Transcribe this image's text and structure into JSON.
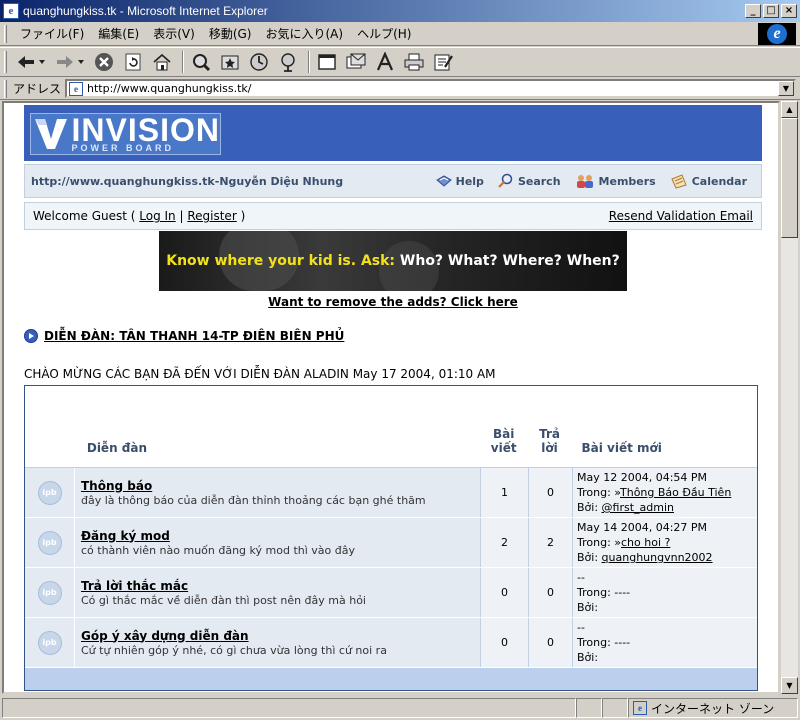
{
  "window": {
    "title": "quanghungkiss.tk - Microsoft Internet Explorer",
    "buttons": {
      "minimize": "_",
      "maximize": "□",
      "close": "×"
    }
  },
  "menu": [
    "ファイル(F)",
    "編集(E)",
    "表示(V)",
    "移動(G)",
    "お気に入り(A)",
    "ヘルプ(H)"
  ],
  "toolbar": {
    "icons": [
      "back-icon",
      "forward-icon",
      "stop-icon",
      "refresh-icon",
      "home-icon",
      "search-icon",
      "favorites-icon",
      "history-icon",
      "channels-icon",
      "fullscreen-icon",
      "mail-icon",
      "font-icon",
      "print-icon",
      "edit-icon"
    ]
  },
  "address": {
    "label": "アドレス",
    "url": "http://www.quanghungkiss.tk/"
  },
  "logo": {
    "big": "INVISION",
    "small": "POWER BOARD"
  },
  "userbar": {
    "site_title": "http://www.quanghungkiss.tk-Nguyễn Diệu Nhung",
    "links": [
      "Help",
      "Search",
      "Members",
      "Calendar"
    ]
  },
  "welcome": {
    "prefix": "Welcome Guest ( ",
    "login": "Log In",
    "sep": " | ",
    "register": "Register",
    "suffix": " )",
    "resend": "Resend Validation Email"
  },
  "banner": {
    "yellow": "Know where your kid is. Ask:",
    "white": " Who? What? Where? When?"
  },
  "remove_ads": "Want to remove the adds? Click here",
  "navstrip": "DIỄN ĐÀN: TÂN THANH 14-TP ĐIÊN BIÊN PHỦ",
  "greeting": "CHÀO MỪNG CÁC BẠN ĐÃ ĐẾN VỚI DIỄN ĐÀN ALADIN May 17 2004, 01:10 AM",
  "forum_table": {
    "headers": {
      "forum": "Diễn đàn",
      "posts_l1": "Bài",
      "posts_l2": "viết",
      "replies_l1": "Trả",
      "replies_l2": "lời",
      "last": "Bài viết mới"
    },
    "rows": [
      {
        "icon": "ipb",
        "name": "Thông báo",
        "desc": "đây là thông báo của diễn đàn thỉnh thoảng các bạn ghé thăm",
        "posts": "1",
        "replies": "0",
        "last_date": "May 12 2004, 04:54 PM",
        "last_in_prefix": "Trong: »",
        "last_in": "Thông Báo Đầu Tiên",
        "last_by_prefix": "Bởi: ",
        "last_by": "@first_admin"
      },
      {
        "icon": "ipb",
        "name": "Đăng ký mod",
        "desc": "có thành viên nào muốn đăng ký mod thì vào đây",
        "posts": "2",
        "replies": "2",
        "last_date": "May 14 2004, 04:27 PM",
        "last_in_prefix": "Trong: »",
        "last_in": "cho hoi ?",
        "last_by_prefix": "Bởi: ",
        "last_by": "quanghungvnn2002"
      },
      {
        "icon": "ipb",
        "name": "Trả lời thắc mắc",
        "desc": "Có gì thắc mắc về diễn đàn thì post nên đây mà hỏi",
        "posts": "0",
        "replies": "0",
        "last_date": "--",
        "last_in_prefix": "Trong: ----",
        "last_in": "",
        "last_by_prefix": "Bởi:",
        "last_by": ""
      },
      {
        "icon": "ipb",
        "name": "Góp ý xây dựng diễn đàn",
        "desc": "Cứ tự nhiên góp ý nhé, có gì chưa vừa lòng thì cứ noi ra",
        "posts": "0",
        "replies": "0",
        "last_date": "--",
        "last_in_prefix": "Trong: ----",
        "last_in": "",
        "last_by_prefix": "Bởi:",
        "last_by": ""
      }
    ]
  },
  "status": {
    "zone": "インターネット ゾーン"
  }
}
